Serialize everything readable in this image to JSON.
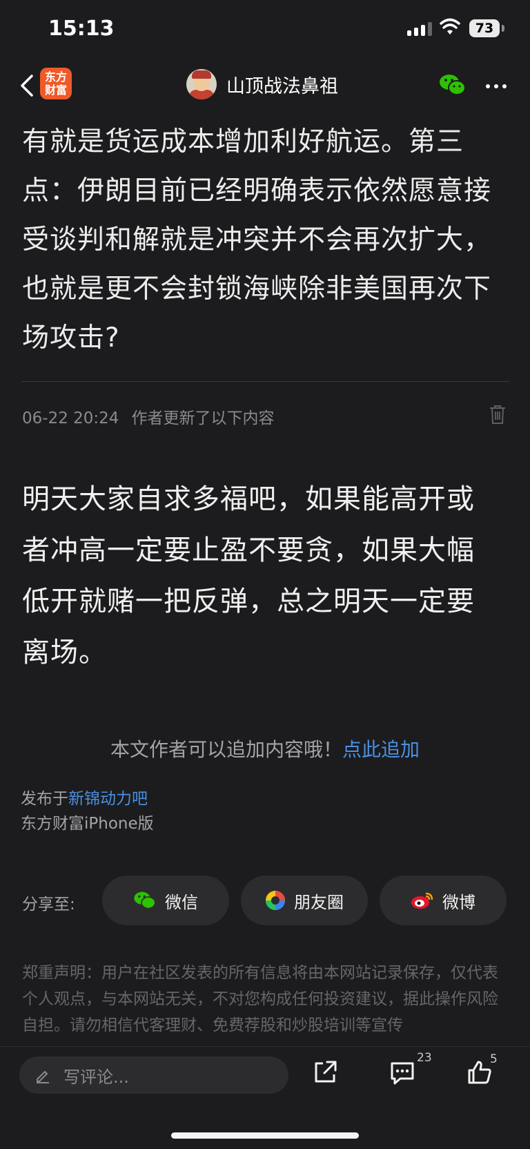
{
  "status_bar": {
    "time": "15:13",
    "battery": "73"
  },
  "nav": {
    "logo_line1": "东方",
    "logo_line2": "财富",
    "author": "山顶战法鼻祖"
  },
  "article": {
    "body": "有就是货运成本增加利好航运。第三点：伊朗目前已经明确表示依然愿意接受谈判和解就是冲突并不会再次扩大，也就是更不会封锁海峡除非美国再次下场攻击?"
  },
  "update": {
    "timestamp": "06-22 20:24",
    "label": "作者更新了以下内容",
    "body": "明天大家自求多福吧，如果能高开或者冲高一定要止盈不要贪，如果大幅低开就赌一把反弹，总之明天一定要离场。"
  },
  "append": {
    "prompt": "本文作者可以追加内容哦！",
    "link": "点此追加"
  },
  "publish": {
    "prefix": "发布于",
    "bar_name": "新锦动力吧",
    "source": "东方财富iPhone版"
  },
  "share": {
    "label": "分享至:",
    "buttons": [
      {
        "label": "微信",
        "icon": "wechat-icon"
      },
      {
        "label": "朋友圈",
        "icon": "moments-icon"
      },
      {
        "label": "微博",
        "icon": "weibo-icon"
      }
    ]
  },
  "disclaimer": "郑重声明：用户在社区发表的所有信息将由本网站记录保存，仅代表个人观点，与本网站无关，不对您构成任何投资建议，据此操作风险自担。请勿相信代客理财、免费荐股和炒股培训等宣传",
  "bottom_bar": {
    "comment_placeholder": "写评论...",
    "comment_count": "23",
    "like_count": "5"
  },
  "colors": {
    "background": "#1c1c1e",
    "link": "#4a90e2",
    "logo": "#ef5a28"
  }
}
